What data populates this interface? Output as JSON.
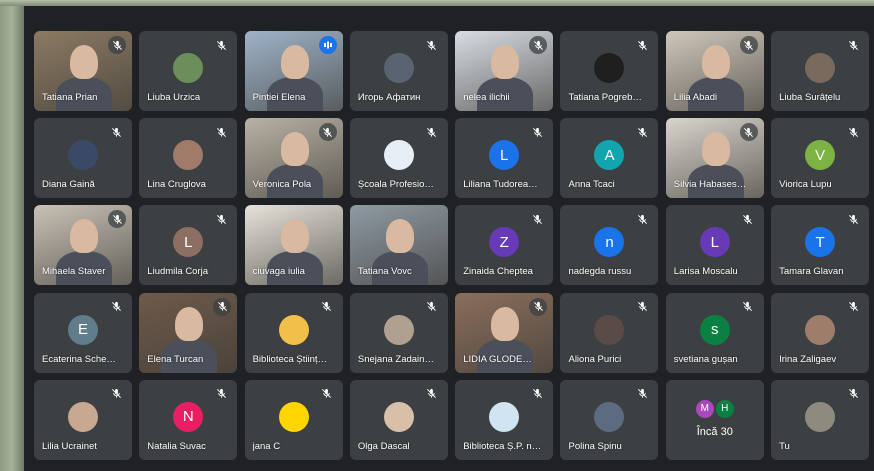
{
  "participants": [
    {
      "name": "Tatiana Prian",
      "muted": true,
      "type": "photo",
      "bg": "#8b7a63"
    },
    {
      "name": "Liuba Urzica",
      "muted": true,
      "type": "avatar",
      "avatar_color": "#6b8e5a",
      "initial": ""
    },
    {
      "name": "Pintiei Elena",
      "muted": false,
      "speaking": true,
      "type": "photo",
      "bg": "#9fb3c8"
    },
    {
      "name": "Игорь Афатин",
      "muted": true,
      "type": "avatar",
      "avatar_color": "#5a6470",
      "initial": ""
    },
    {
      "name": "nelea ilichii",
      "muted": true,
      "type": "photo",
      "bg": "#d8dde3"
    },
    {
      "name": "Tatiana Pogreb…",
      "muted": true,
      "type": "avatar",
      "avatar_color": "#1f1f1f",
      "initial": ""
    },
    {
      "name": "Lilia Abadi",
      "muted": true,
      "type": "photo",
      "bg": "#cfc7bb"
    },
    {
      "name": "Liuba Surâțelu",
      "muted": true,
      "type": "avatar",
      "avatar_color": "#7a6a5e",
      "initial": ""
    },
    {
      "name": "Diana Gaină",
      "muted": true,
      "type": "avatar",
      "avatar_color": "#3a4a66",
      "initial": ""
    },
    {
      "name": "Lina Cruglova",
      "muted": true,
      "type": "avatar",
      "avatar_color": "#a07b6a",
      "initial": ""
    },
    {
      "name": "Veronica Pola",
      "muted": true,
      "type": "photo",
      "bg": "#b9b2a4"
    },
    {
      "name": "Școala Profesio…",
      "muted": true,
      "type": "avatar",
      "avatar_color": "#e8eef5",
      "initial": ""
    },
    {
      "name": "Liliana Tudorea…",
      "muted": true,
      "type": "avatar",
      "avatar_color": "#1a73e8",
      "initial": "L"
    },
    {
      "name": "Anna Tcaci",
      "muted": true,
      "type": "avatar",
      "avatar_color": "#12a4af",
      "initial": "A"
    },
    {
      "name": "Silvia Habases…",
      "muted": true,
      "type": "photo",
      "bg": "#d9d4cc"
    },
    {
      "name": "Viorica Lupu",
      "muted": true,
      "type": "avatar",
      "avatar_color": "#7cb342",
      "initial": "V"
    },
    {
      "name": "Mihaela Staver",
      "muted": true,
      "type": "photo",
      "bg": "#c9c2b6"
    },
    {
      "name": "Liudmila Corja",
      "muted": true,
      "type": "avatar",
      "avatar_color": "#8d6e63",
      "initial": "L"
    },
    {
      "name": "ciuvaga iulia",
      "muted": false,
      "type": "photo",
      "bg": "#e6e2da"
    },
    {
      "name": "Tatiana Vovc",
      "muted": false,
      "type": "photo",
      "bg": "#8f9aa3"
    },
    {
      "name": "Zinaida Cheptea",
      "muted": true,
      "type": "avatar",
      "avatar_color": "#673ab7",
      "initial": "Z"
    },
    {
      "name": "nadegda russu",
      "muted": true,
      "type": "avatar",
      "avatar_color": "#1a73e8",
      "initial": "n"
    },
    {
      "name": "Larisa Moscalu",
      "muted": true,
      "type": "avatar",
      "avatar_color": "#673ab7",
      "initial": "L"
    },
    {
      "name": "Tamara Glavan",
      "muted": true,
      "type": "avatar",
      "avatar_color": "#1a73e8",
      "initial": "T"
    },
    {
      "name": "Ecaterina Sche…",
      "muted": true,
      "type": "avatar",
      "avatar_color": "#607d8b",
      "initial": "E"
    },
    {
      "name": "Elena Turcan",
      "muted": true,
      "type": "photo",
      "bg": "#6e5a4a"
    },
    {
      "name": "Biblioteca Științ…",
      "muted": true,
      "type": "avatar",
      "avatar_color": "#f2c04a",
      "initial": ""
    },
    {
      "name": "Snejana Zadain…",
      "muted": true,
      "type": "avatar",
      "avatar_color": "#b0a090",
      "initial": ""
    },
    {
      "name": "LIDIA GLODE…",
      "muted": true,
      "type": "photo",
      "bg": "#8a6e5c"
    },
    {
      "name": "Aliona Purici",
      "muted": true,
      "type": "avatar",
      "avatar_color": "#5a4a48",
      "initial": ""
    },
    {
      "name": "svetiana gușan",
      "muted": true,
      "type": "avatar",
      "avatar_color": "#0b8043",
      "initial": "s"
    },
    {
      "name": "Irina Zaligaev",
      "muted": true,
      "type": "avatar",
      "avatar_color": "#9c7e6a",
      "initial": ""
    },
    {
      "name": "Lilia Ucrainet",
      "muted": true,
      "type": "avatar",
      "avatar_color": "#c8a890",
      "initial": ""
    },
    {
      "name": "Natalia Suvac",
      "muted": true,
      "type": "avatar",
      "avatar_color": "#e91e63",
      "initial": "N"
    },
    {
      "name": "jana C",
      "muted": true,
      "type": "avatar",
      "avatar_color": "#ffd600",
      "initial": ""
    },
    {
      "name": "Olga Dascal",
      "muted": true,
      "type": "avatar",
      "avatar_color": "#d8c0a8",
      "initial": ""
    },
    {
      "name": "Biblioteca Ș.P. n…",
      "muted": true,
      "type": "avatar",
      "avatar_color": "#d0e4f2",
      "initial": ""
    },
    {
      "name": "Polina Spinu",
      "muted": true,
      "type": "avatar",
      "avatar_color": "#5c6b80",
      "initial": ""
    },
    {
      "name": "",
      "muted": false,
      "type": "more",
      "more_label": "Încă 30",
      "more_initials": [
        "M",
        "H"
      ],
      "more_colors": [
        "#ab47bc",
        "#0b8043"
      ]
    },
    {
      "name": "Tu",
      "muted": true,
      "type": "avatar",
      "avatar_color": "#8d8a80",
      "initial": ""
    }
  ],
  "colors": {
    "background": "#202124",
    "tile": "#3c4043",
    "speaking": "#8ab4f8"
  }
}
